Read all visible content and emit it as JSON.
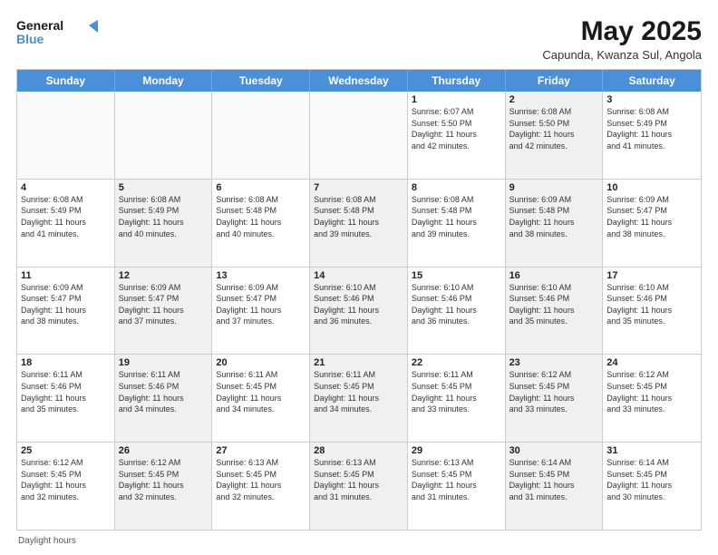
{
  "header": {
    "logo_line1": "General",
    "logo_line2": "Blue",
    "month_year": "May 2025",
    "location": "Capunda, Kwanza Sul, Angola"
  },
  "days_of_week": [
    "Sunday",
    "Monday",
    "Tuesday",
    "Wednesday",
    "Thursday",
    "Friday",
    "Saturday"
  ],
  "footer_text": "Daylight hours",
  "weeks": [
    [
      {
        "num": "",
        "info": "",
        "empty": true
      },
      {
        "num": "",
        "info": "",
        "empty": true
      },
      {
        "num": "",
        "info": "",
        "empty": true
      },
      {
        "num": "",
        "info": "",
        "empty": true
      },
      {
        "num": "1",
        "info": "Sunrise: 6:07 AM\nSunset: 5:50 PM\nDaylight: 11 hours\nand 42 minutes."
      },
      {
        "num": "2",
        "info": "Sunrise: 6:08 AM\nSunset: 5:50 PM\nDaylight: 11 hours\nand 42 minutes.",
        "shaded": true
      },
      {
        "num": "3",
        "info": "Sunrise: 6:08 AM\nSunset: 5:49 PM\nDaylight: 11 hours\nand 41 minutes."
      }
    ],
    [
      {
        "num": "4",
        "info": "Sunrise: 6:08 AM\nSunset: 5:49 PM\nDaylight: 11 hours\nand 41 minutes."
      },
      {
        "num": "5",
        "info": "Sunrise: 6:08 AM\nSunset: 5:49 PM\nDaylight: 11 hours\nand 40 minutes.",
        "shaded": true
      },
      {
        "num": "6",
        "info": "Sunrise: 6:08 AM\nSunset: 5:48 PM\nDaylight: 11 hours\nand 40 minutes."
      },
      {
        "num": "7",
        "info": "Sunrise: 6:08 AM\nSunset: 5:48 PM\nDaylight: 11 hours\nand 39 minutes.",
        "shaded": true
      },
      {
        "num": "8",
        "info": "Sunrise: 6:08 AM\nSunset: 5:48 PM\nDaylight: 11 hours\nand 39 minutes."
      },
      {
        "num": "9",
        "info": "Sunrise: 6:09 AM\nSunset: 5:48 PM\nDaylight: 11 hours\nand 38 minutes.",
        "shaded": true
      },
      {
        "num": "10",
        "info": "Sunrise: 6:09 AM\nSunset: 5:47 PM\nDaylight: 11 hours\nand 38 minutes."
      }
    ],
    [
      {
        "num": "11",
        "info": "Sunrise: 6:09 AM\nSunset: 5:47 PM\nDaylight: 11 hours\nand 38 minutes."
      },
      {
        "num": "12",
        "info": "Sunrise: 6:09 AM\nSunset: 5:47 PM\nDaylight: 11 hours\nand 37 minutes.",
        "shaded": true
      },
      {
        "num": "13",
        "info": "Sunrise: 6:09 AM\nSunset: 5:47 PM\nDaylight: 11 hours\nand 37 minutes."
      },
      {
        "num": "14",
        "info": "Sunrise: 6:10 AM\nSunset: 5:46 PM\nDaylight: 11 hours\nand 36 minutes.",
        "shaded": true
      },
      {
        "num": "15",
        "info": "Sunrise: 6:10 AM\nSunset: 5:46 PM\nDaylight: 11 hours\nand 36 minutes."
      },
      {
        "num": "16",
        "info": "Sunrise: 6:10 AM\nSunset: 5:46 PM\nDaylight: 11 hours\nand 35 minutes.",
        "shaded": true
      },
      {
        "num": "17",
        "info": "Sunrise: 6:10 AM\nSunset: 5:46 PM\nDaylight: 11 hours\nand 35 minutes."
      }
    ],
    [
      {
        "num": "18",
        "info": "Sunrise: 6:11 AM\nSunset: 5:46 PM\nDaylight: 11 hours\nand 35 minutes."
      },
      {
        "num": "19",
        "info": "Sunrise: 6:11 AM\nSunset: 5:46 PM\nDaylight: 11 hours\nand 34 minutes.",
        "shaded": true
      },
      {
        "num": "20",
        "info": "Sunrise: 6:11 AM\nSunset: 5:45 PM\nDaylight: 11 hours\nand 34 minutes."
      },
      {
        "num": "21",
        "info": "Sunrise: 6:11 AM\nSunset: 5:45 PM\nDaylight: 11 hours\nand 34 minutes.",
        "shaded": true
      },
      {
        "num": "22",
        "info": "Sunrise: 6:11 AM\nSunset: 5:45 PM\nDaylight: 11 hours\nand 33 minutes."
      },
      {
        "num": "23",
        "info": "Sunrise: 6:12 AM\nSunset: 5:45 PM\nDaylight: 11 hours\nand 33 minutes.",
        "shaded": true
      },
      {
        "num": "24",
        "info": "Sunrise: 6:12 AM\nSunset: 5:45 PM\nDaylight: 11 hours\nand 33 minutes."
      }
    ],
    [
      {
        "num": "25",
        "info": "Sunrise: 6:12 AM\nSunset: 5:45 PM\nDaylight: 11 hours\nand 32 minutes."
      },
      {
        "num": "26",
        "info": "Sunrise: 6:12 AM\nSunset: 5:45 PM\nDaylight: 11 hours\nand 32 minutes.",
        "shaded": true
      },
      {
        "num": "27",
        "info": "Sunrise: 6:13 AM\nSunset: 5:45 PM\nDaylight: 11 hours\nand 32 minutes."
      },
      {
        "num": "28",
        "info": "Sunrise: 6:13 AM\nSunset: 5:45 PM\nDaylight: 11 hours\nand 31 minutes.",
        "shaded": true
      },
      {
        "num": "29",
        "info": "Sunrise: 6:13 AM\nSunset: 5:45 PM\nDaylight: 11 hours\nand 31 minutes."
      },
      {
        "num": "30",
        "info": "Sunrise: 6:14 AM\nSunset: 5:45 PM\nDaylight: 11 hours\nand 31 minutes.",
        "shaded": true
      },
      {
        "num": "31",
        "info": "Sunrise: 6:14 AM\nSunset: 5:45 PM\nDaylight: 11 hours\nand 30 minutes."
      }
    ]
  ]
}
